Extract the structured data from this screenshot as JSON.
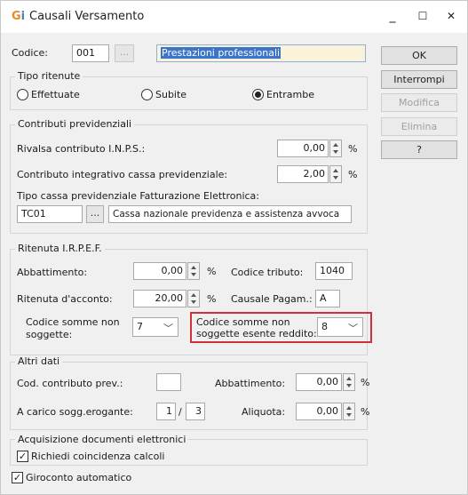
{
  "window": {
    "title": "Causali Versamento",
    "minimize": "_",
    "maximize": "☐",
    "close": "✕",
    "icon": "app-logo-icon"
  },
  "header": {
    "codice_label": "Codice:",
    "codice_value": "001",
    "lookup_button": "...",
    "description_value": "Prestazioni professionali"
  },
  "tipo_ritenute": {
    "title": "Tipo ritenute",
    "options": [
      "Effettuate",
      "Subite",
      "Entrambe"
    ],
    "selected": "Entrambe"
  },
  "contributi": {
    "title": "Contributi previdenziali",
    "rivalsa_label": "Rivalsa contributo I.N.P.S.:",
    "rivalsa_value": "0,00",
    "integrativo_label": "Contributo integrativo cassa previdenziale:",
    "integrativo_value": "2,00",
    "percent": "%",
    "tipo_cassa_label": "Tipo cassa previdenziale Fatturazione Elettronica:",
    "tipo_cassa_code": "TC01",
    "tipo_cassa_button": "...",
    "tipo_cassa_desc": "Cassa nazionale previdenza e assistenza avvoca"
  },
  "irpef": {
    "title": "Ritenuta I.R.P.E.F.",
    "abbattimento_label": "Abbattimento:",
    "abbattimento_value": "0,00",
    "codice_tributo_label": "Codice tributo:",
    "codice_tributo_value": "1040",
    "ritenuta_label": "Ritenuta d'acconto:",
    "ritenuta_value": "20,00",
    "causale_label": "Causale Pagam.:",
    "causale_value": "A",
    "somme_non_sogg_label_1": "Codice somme non",
    "somme_non_sogg_label_2": "soggette:",
    "somme_non_sogg_value": "7",
    "somme_esente_label_1": "Codice somme non",
    "somme_esente_label_2": "soggette esente reddito:",
    "somme_esente_value": "8",
    "percent": "%",
    "highlight_color": "#d0303a"
  },
  "altri_dati": {
    "title": "Altri dati",
    "cod_contributo_label": "Cod. contributo prev.:",
    "cod_contributo_value": "",
    "abbattimento_label": "Abbattimento:",
    "abbattimento_value": "0,00",
    "a_carico_label": "A carico sogg.erogante:",
    "a_carico_num": "1",
    "a_carico_sep": "/",
    "a_carico_den": "3",
    "aliquota_label": "Aliquota:",
    "aliquota_value": "0,00",
    "percent": "%"
  },
  "acquisizione": {
    "title": "Acquisizione documenti elettronici",
    "checkbox_label": "Richiedi coincidenza calcoli",
    "checked": true
  },
  "giroconto": {
    "checkbox_label": "Giroconto automatico",
    "checked": true
  },
  "buttons": {
    "ok": "OK",
    "interrompi": "Interrompi",
    "modifica": "Modifica",
    "elimina": "Elimina",
    "help": "?"
  }
}
